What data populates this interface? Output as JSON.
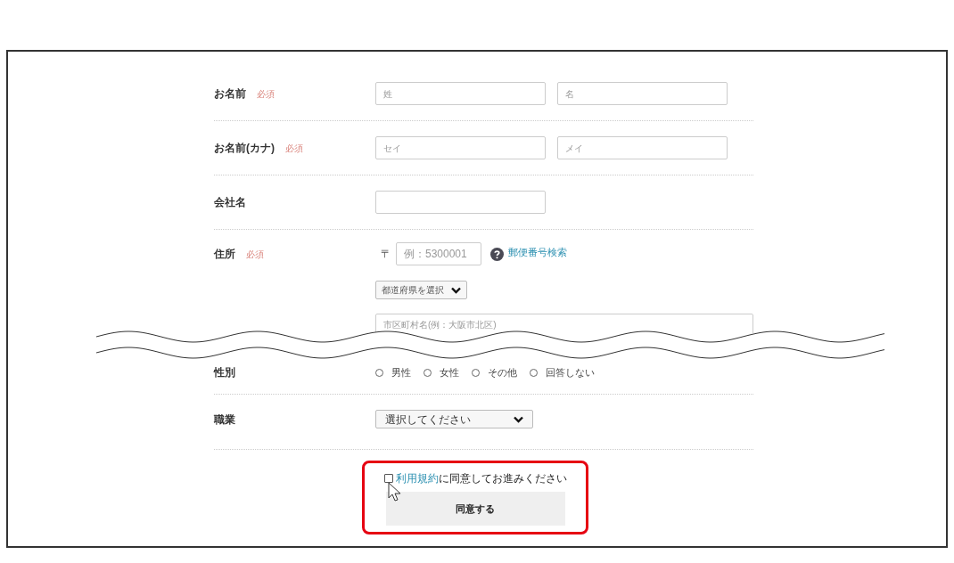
{
  "form": {
    "rows": [
      {
        "kind": "pair",
        "label": "お名前",
        "badge": "必須",
        "placeholders": [
          "姓",
          "名"
        ]
      },
      {
        "kind": "pair",
        "label": "お名前(カナ)",
        "badge": "必須",
        "placeholders": [
          "セイ",
          "メイ"
        ]
      },
      {
        "kind": "single",
        "label": "会社名"
      },
      {
        "kind": "address",
        "label": "住所",
        "badge": "必須",
        "postal_mark": "〒",
        "zip_placeholder": "例：5300001",
        "zip_search_link": "郵便番号検索",
        "prefecture_select": "都道府県を選択",
        "city_placeholder": "市区町村名(例：大阪市北区)"
      }
    ],
    "rows_after_break": [
      {
        "kind": "radio",
        "label": "性別",
        "options": [
          {
            "label": "男性",
            "selected": false
          },
          {
            "label": "女性",
            "selected": false
          },
          {
            "label": "その他",
            "selected": false
          },
          {
            "label": "回答しない",
            "selected": false
          }
        ]
      },
      {
        "kind": "select",
        "label": "職業",
        "value": "選択してください"
      }
    ]
  },
  "agreement": {
    "checked": false,
    "terms_link": "利用規約",
    "text": "に同意してお進みください",
    "button": "同意する"
  }
}
